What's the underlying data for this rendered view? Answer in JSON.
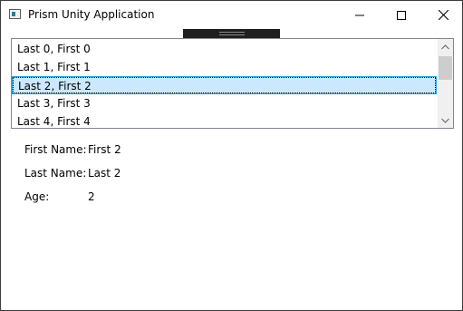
{
  "window": {
    "title": "Prism Unity Application"
  },
  "people_list": {
    "items": [
      "Last 0, First 0",
      "Last 1, First 1",
      "Last 2, First 2",
      "Last 3, First 3",
      "Last 4, First 4"
    ],
    "selected_index": 2
  },
  "details": {
    "first_name_label": "First Name:",
    "first_name_value": "First 2",
    "last_name_label": "Last Name:",
    "last_name_value": "Last 2",
    "age_label": "Age:",
    "age_value": "2"
  },
  "colors": {
    "selection_bg": "#cce8ff",
    "selection_border": "#26a0da",
    "dock_bar": "#1f1f1f"
  },
  "icons": {
    "app": "app-window-icon",
    "minimize": "minimize-icon",
    "maximize": "maximize-icon",
    "close": "close-icon",
    "scroll_up": "chevron-up-icon",
    "scroll_down": "chevron-down-icon"
  }
}
